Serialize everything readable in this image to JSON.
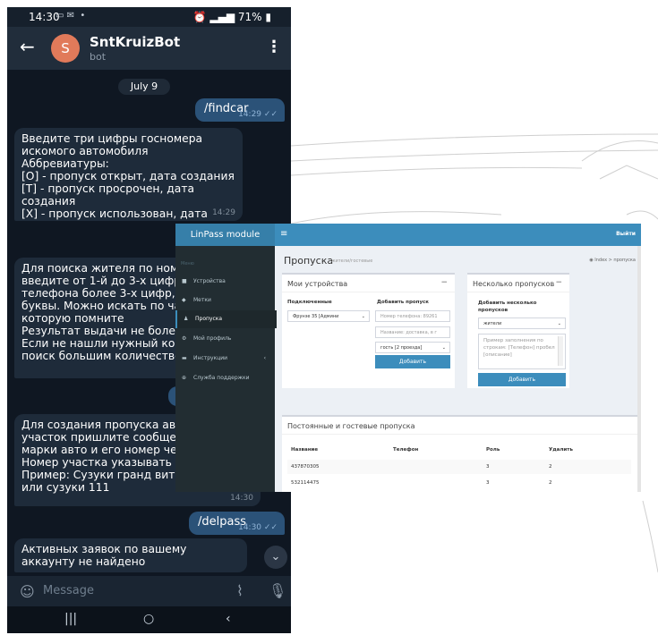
{
  "phone": {
    "status": {
      "time": "14:30",
      "battery": "71%"
    },
    "header": {
      "avatar_letter": "S",
      "title": "SntKruizBot",
      "subtitle": "bot"
    },
    "date_separator": "July 9",
    "messages": [
      {
        "dir": "out",
        "text": "/findcar",
        "time": "14:29"
      },
      {
        "dir": "in",
        "text": "Введите три цифры госномера искомого автомобиля\nАббревиатуры:\n[O] - пропуск открыт, дата создания\n[T] - пропуск просрочен, дата создания\n[X] - пропуск использован, дата проезда",
        "time": "14:29"
      },
      {
        "dir": "in",
        "text": "Для поиска жителя по номер\nвведите от 1-й до 3-х цифр, по\nтелефона более 3-х цифр, по\nбуквы. Можно искать по част\nкоторую помните\nРезультат выдачи не более 50\nЕсли не нашли нужный конта\nпоиск большим количеством",
        "time": ""
      },
      {
        "dir": "in",
        "text": "Для создания пропуска авто\nучасток пришлите сообщение\nмарки авто и его номер через\nНомер участка указывать не\nПример: Сузуки гранд витара\n или сузуки 111",
        "time": "14:30"
      },
      {
        "dir": "out",
        "text": "/delpass",
        "time": "14:30"
      },
      {
        "dir": "in",
        "text": "Активных заявок по вашему аккаунту не найдено",
        "time": ""
      }
    ],
    "composer": {
      "placeholder": "Message"
    }
  },
  "linpass": {
    "brand": "LinPass module",
    "logout": "Выйти",
    "sidebar": {
      "header": "Меню",
      "items": [
        {
          "label": "Устройства"
        },
        {
          "label": "Метки"
        },
        {
          "label": "Пропуска"
        },
        {
          "label": "Мой профиль"
        },
        {
          "label": "Инструкции"
        },
        {
          "label": "Служба поддержки"
        }
      ]
    },
    "page": {
      "title": "Пропуска",
      "subtitle": "жители/гостевые"
    },
    "breadcrumb": {
      "home": "Index",
      "current": "пропуска"
    },
    "devices_box": {
      "title": "Мои устройства",
      "connected_label": "Подключенные",
      "connected_value": "Фрунзе 35 [Админи",
      "add_label": "Добавить пропуск",
      "phone_placeholder": "Номер телефона: 89261",
      "name_placeholder": "Название: доставка, в г",
      "type_value": "гость [2 проезда]",
      "add_button": "Добавить"
    },
    "bulk_box": {
      "title": "Несколько пропусков",
      "label": "Добавить несколько пропусков",
      "role_value": "жители",
      "textarea_placeholder": "Пример заполнения по строкам: [Телефон] пробел [описание]",
      "add_button": "Добавить"
    },
    "passes_box": {
      "title": "Постоянные и гостевые пропуска",
      "columns": [
        "Название",
        "Телефон",
        "Роль",
        "Удалить"
      ],
      "rows": [
        [
          "437870305",
          "",
          "3",
          "2"
        ],
        [
          "532114475",
          "",
          "3",
          "2"
        ]
      ]
    }
  }
}
